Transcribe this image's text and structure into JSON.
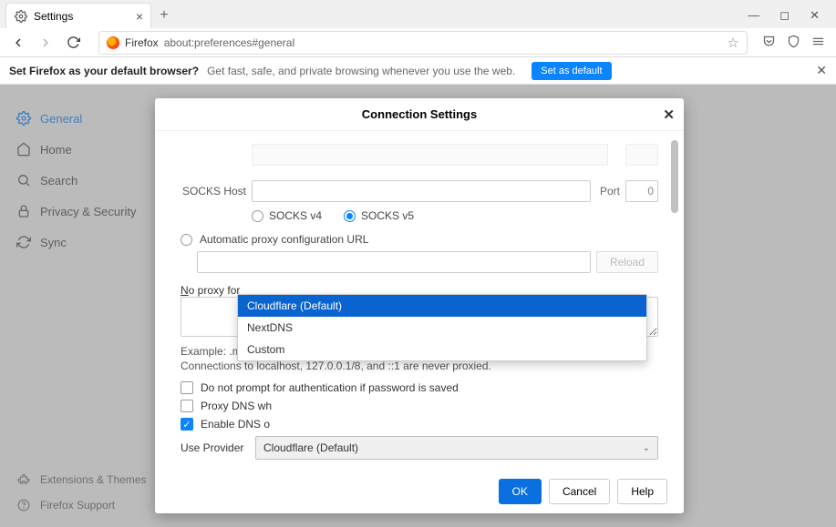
{
  "tabbar": {
    "tab_title": "Settings"
  },
  "toolbar": {
    "identity_label": "Firefox",
    "url": "about:preferences#general"
  },
  "default_bar": {
    "bold": "Set Firefox as your default browser?",
    "sub": "Get fast, safe, and private browsing whenever you use the web.",
    "button": "Set as default"
  },
  "sidebar": {
    "items": [
      {
        "label": "General"
      },
      {
        "label": "Home"
      },
      {
        "label": "Search"
      },
      {
        "label": "Privacy & Security"
      },
      {
        "label": "Sync"
      }
    ],
    "bottom": [
      {
        "label": "Extensions & Themes"
      },
      {
        "label": "Firefox Support"
      }
    ]
  },
  "dialog": {
    "title": "Connection Settings",
    "socks_host_label": "SOCKS Host",
    "port_label": "Port",
    "port_value": "0",
    "socks_v4": "SOCKS v4",
    "socks_v5": "SOCKS v5",
    "auto_pac_label": "Automatic proxy configuration URL",
    "reload": "Reload",
    "no_proxy_label": "No proxy for",
    "example": "Example: .mozilla.org, .net.nz, 192.168.1.0/24",
    "localhost_note": "Connections to localhost, 127.0.0.1/8, and ::1 are never proxied.",
    "chk_noauth": "Do not prompt for authentication if password is saved",
    "chk_proxydns_prefix": "Proxy DNS wh",
    "chk_doh_prefix": "Enable DNS o",
    "use_provider_label": "Use Provider",
    "selected_provider": "Cloudflare (Default)",
    "dropdown": [
      "Cloudflare (Default)",
      "NextDNS",
      "Custom"
    ],
    "buttons": {
      "ok": "OK",
      "cancel": "Cancel",
      "help": "Help"
    }
  }
}
